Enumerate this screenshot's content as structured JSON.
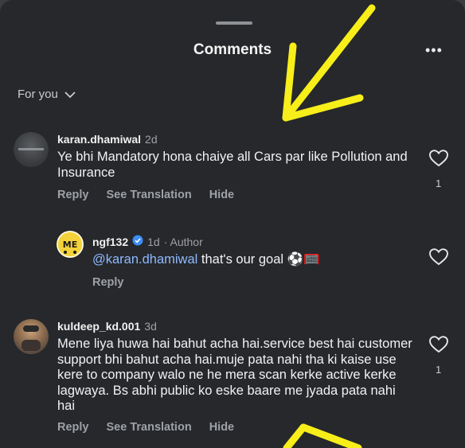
{
  "header": {
    "title": "Comments",
    "more_label": "•••",
    "filter_label": "For you"
  },
  "comments": [
    {
      "username": "karan.dhamiwal",
      "time": "2d",
      "text": "Ye bhi Mandatory hona chaiye all Cars par like Pollution and Insurance",
      "actions": [
        "Reply",
        "See Translation",
        "Hide"
      ],
      "likes": "1"
    },
    {
      "username": "ngf132",
      "time": "1d",
      "author_badge": "· Author",
      "mention": "@karan.dhamiwal",
      "text": " that's our goal ⚽🥅",
      "actions": [
        "Reply"
      ]
    },
    {
      "username": "kuldeep_kd.001",
      "time": "3d",
      "text": "Mene liya huwa hai bahut acha hai.service best hai customer support bhi bahut acha hai.muje pata nahi tha ki kaise use kere to company walo ne he mera scan kerke active kerke lagwaya. Bs abhi public ko eske baare me jyada pata nahi hai",
      "actions": [
        "Reply",
        "See Translation",
        "Hide"
      ],
      "likes": "1"
    }
  ],
  "colors": {
    "background": "#26282b",
    "mention": "#8fb9ff",
    "annotation_arrow": "#f7ee1a"
  },
  "icons": [
    "chevron-down-icon",
    "heart-outline-icon",
    "verified-badge-icon",
    "more-dots-icon"
  ]
}
